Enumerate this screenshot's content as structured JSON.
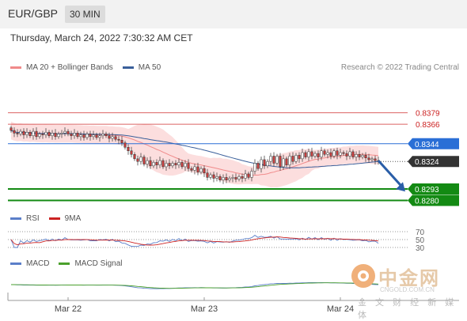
{
  "header": {
    "pair": "EUR/GBP",
    "timeframe": "30 MIN"
  },
  "timestamp": "Thursday, March 24, 2022 7:30:32 AM CET",
  "credit": "Research © 2022 Trading Central",
  "legend_main": [
    {
      "label": "MA 20 + Bollinger Bands",
      "color": "#f08a8a"
    },
    {
      "label": "MA 50",
      "color": "#3a5f9a"
    }
  ],
  "legend_rsi": [
    {
      "label": "RSI",
      "color": "#5b7fc9"
    },
    {
      "label": "9MA",
      "color": "#cc2222"
    }
  ],
  "legend_macd": [
    {
      "label": "MACD",
      "color": "#5b7fc9"
    },
    {
      "label": "MACD Signal",
      "color": "#4aa02c"
    }
  ],
  "watermark": {
    "name": "中金网",
    "url": "CNGOLD.COM.CN",
    "sub": "金 文 财 经 新 媒 体"
  },
  "chart_data": {
    "type": "candlestick",
    "x_tick_labels": [
      "Mar 22",
      "Mar 23",
      "Mar 24"
    ],
    "levels": [
      {
        "value": 0.8379,
        "label": "0.8379",
        "kind": "resistance",
        "color": "#cc2222"
      },
      {
        "value": 0.8366,
        "label": "0.8366",
        "kind": "resistance",
        "color": "#cc2222"
      },
      {
        "value": 0.8344,
        "label": "0.8344",
        "kind": "pivot",
        "color": "#2a6fd6"
      },
      {
        "value": 0.8324,
        "label": "0.8324",
        "kind": "last",
        "color": "#333333"
      },
      {
        "value": 0.8293,
        "label": "0.8293",
        "kind": "support",
        "color": "#138a13"
      },
      {
        "value": 0.828,
        "label": "0.8280",
        "kind": "support",
        "color": "#138a13"
      }
    ],
    "y_range": [
      0.8276,
      0.8392
    ],
    "close": [
      0.8359,
      0.8356,
      0.8355,
      0.8358,
      0.8354,
      0.8357,
      0.8353,
      0.8358,
      0.8352,
      0.8355,
      0.8354,
      0.8357,
      0.8353,
      0.8356,
      0.8352,
      0.8355,
      0.8356,
      0.8358,
      0.8355,
      0.8353,
      0.8356,
      0.8352,
      0.8354,
      0.8351,
      0.8355,
      0.8352,
      0.8354,
      0.8351,
      0.8353,
      0.8355,
      0.8353,
      0.835,
      0.8352,
      0.8349,
      0.8348,
      0.8345,
      0.834,
      0.8336,
      0.8332,
      0.8327,
      0.8324,
      0.8329,
      0.8321,
      0.8325,
      0.8319,
      0.8323,
      0.832,
      0.8325,
      0.8318,
      0.8322,
      0.8319,
      0.8322,
      0.832,
      0.8323,
      0.8318,
      0.8322,
      0.8316,
      0.8314,
      0.8318,
      0.8312,
      0.8316,
      0.8311,
      0.8306,
      0.8309,
      0.8305,
      0.8307,
      0.8303,
      0.8306,
      0.8303,
      0.8305,
      0.8306,
      0.8304,
      0.8307,
      0.8305,
      0.831,
      0.8306,
      0.8313,
      0.8322,
      0.8316,
      0.8326,
      0.8319,
      0.8324,
      0.833,
      0.8322,
      0.833,
      0.8318,
      0.8327,
      0.832,
      0.833,
      0.8324,
      0.8331,
      0.8327,
      0.8334,
      0.8329,
      0.8335,
      0.833,
      0.8333,
      0.8329,
      0.8336,
      0.8332,
      0.8334,
      0.833,
      0.8336,
      0.8331,
      0.8334,
      0.8333,
      0.833,
      0.8335,
      0.8329,
      0.8332,
      0.8329,
      0.8331,
      0.8328,
      0.8326,
      0.8327,
      0.8325,
      0.8324
    ],
    "forecast_arrow": {
      "from": 0.8325,
      "to": 0.829
    },
    "rsi": {
      "levels": [
        70,
        50,
        30
      ]
    }
  }
}
